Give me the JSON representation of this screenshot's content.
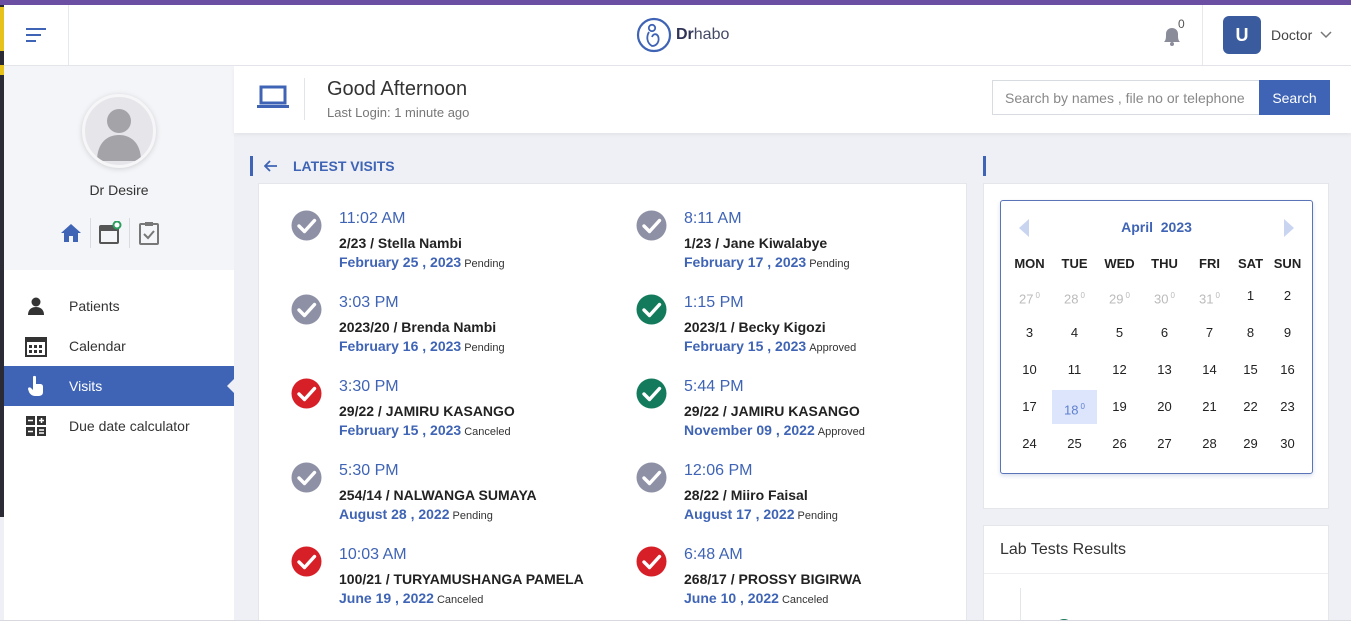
{
  "app": {
    "logo_bold": "Dr",
    "logo_rest": "habo"
  },
  "header": {
    "notifications_count": "0",
    "user_initial": "U",
    "user_name": "Doctor"
  },
  "profile": {
    "name": "Dr Desire"
  },
  "nav": [
    {
      "label": "Patients",
      "icon": "user-icon"
    },
    {
      "label": "Calendar",
      "icon": "calendar-icon"
    },
    {
      "label": "Visits",
      "icon": "pointer-hand-icon",
      "active": true
    },
    {
      "label": "Due date calculator",
      "icon": "calculator-icon"
    }
  ],
  "greeting": {
    "title": "Good Afternoon",
    "subtitle": "Last Login: 1 minute ago"
  },
  "search": {
    "placeholder": "Search by names , file no or telephone",
    "button": "Search"
  },
  "latest_visits": {
    "title": "LATEST VISITS",
    "items": [
      {
        "time": "11:02 AM",
        "name": "2/23 / Stella Nambi",
        "date": "February 25 , 2023",
        "status": "Pending"
      },
      {
        "time": "8:11 AM",
        "name": "1/23 / Jane Kiwalabye",
        "date": "February 17 , 2023",
        "status": "Pending"
      },
      {
        "time": "3:03 PM",
        "name": "2023/20 / Brenda Nambi",
        "date": "February 16 , 2023",
        "status": "Pending"
      },
      {
        "time": "1:15 PM",
        "name": "2023/1 / Becky Kigozi",
        "date": "February 15 , 2023",
        "status": "Approved"
      },
      {
        "time": "3:30 PM",
        "name": "29/22 / JAMIRU KASANGO",
        "date": "February 15 , 2023",
        "status": "Canceled"
      },
      {
        "time": "5:44 PM",
        "name": "29/22 / JAMIRU KASANGO",
        "date": "November 09 , 2022",
        "status": "Approved"
      },
      {
        "time": "5:30 PM",
        "name": "254/14 / NALWANGA SUMAYA",
        "date": "August 28 , 2022",
        "status": "Pending"
      },
      {
        "time": "12:06 PM",
        "name": "28/22 / Miiro Faisal",
        "date": "August 17 , 2022",
        "status": "Pending"
      },
      {
        "time": "10:03 AM",
        "name": "100/21 / TURYAMUSHANGA PAMELA",
        "date": "June 19 , 2022",
        "status": "Canceled"
      },
      {
        "time": "6:48 AM",
        "name": "268/17 / PROSSY BIGIRWA",
        "date": "June 10 , 2022",
        "status": "Canceled"
      }
    ]
  },
  "status_colors": {
    "Pending": "#8e90a6",
    "Approved": "#137a5b",
    "Canceled": "#d61f26"
  },
  "calendar": {
    "month": "April",
    "year": "2023",
    "weekdays": [
      "MON",
      "TUE",
      "WED",
      "THU",
      "FRI",
      "SAT",
      "SUN"
    ],
    "weeks": [
      [
        {
          "d": "27",
          "badge": "0",
          "muted": true
        },
        {
          "d": "28",
          "badge": "0",
          "muted": true
        },
        {
          "d": "29",
          "badge": "0",
          "muted": true
        },
        {
          "d": "30",
          "badge": "0",
          "muted": true
        },
        {
          "d": "31",
          "badge": "0",
          "muted": true
        },
        {
          "d": "1"
        },
        {
          "d": "2"
        }
      ],
      [
        {
          "d": "3"
        },
        {
          "d": "4"
        },
        {
          "d": "5"
        },
        {
          "d": "6"
        },
        {
          "d": "7"
        },
        {
          "d": "8"
        },
        {
          "d": "9"
        }
      ],
      [
        {
          "d": "10"
        },
        {
          "d": "11"
        },
        {
          "d": "12"
        },
        {
          "d": "13"
        },
        {
          "d": "14"
        },
        {
          "d": "15"
        },
        {
          "d": "16"
        }
      ],
      [
        {
          "d": "17"
        },
        {
          "d": "18",
          "badge": "0",
          "today": true
        },
        {
          "d": "19"
        },
        {
          "d": "20"
        },
        {
          "d": "21"
        },
        {
          "d": "22"
        },
        {
          "d": "23"
        }
      ],
      [
        {
          "d": "24"
        },
        {
          "d": "25"
        },
        {
          "d": "26"
        },
        {
          "d": "27"
        },
        {
          "d": "28"
        },
        {
          "d": "29"
        },
        {
          "d": "30"
        }
      ]
    ]
  },
  "lab": {
    "title": "Lab Tests Results"
  }
}
